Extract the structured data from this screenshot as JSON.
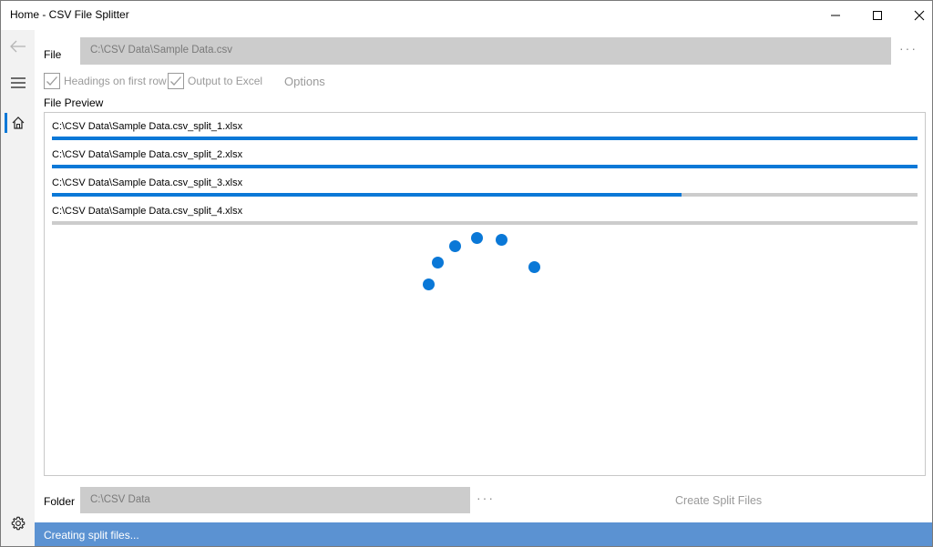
{
  "window": {
    "title": "Home - CSV File Splitter"
  },
  "nav": {
    "back_icon": "back-arrow-icon",
    "menu_icon": "hamburger-icon",
    "home_icon": "home-icon",
    "settings_icon": "gear-icon"
  },
  "file": {
    "label": "File",
    "path": "C:\\CSV Data\\Sample Data.csv",
    "browse": "···"
  },
  "options": {
    "headings_label": "Headings on first row",
    "headings_checked": true,
    "excel_label": "Output to Excel",
    "excel_checked": true,
    "options_label": "Options"
  },
  "preview": {
    "label": "File Preview",
    "items": [
      {
        "name": "C:\\CSV Data\\Sample Data.csv_split_1.xlsx",
        "progress": 1.0
      },
      {
        "name": "C:\\CSV Data\\Sample Data.csv_split_2.xlsx",
        "progress": 1.0
      },
      {
        "name": "C:\\CSV Data\\Sample Data.csv_split_3.xlsx",
        "progress": 0.727
      },
      {
        "name": "C:\\CSV Data\\Sample Data.csv_split_4.xlsx",
        "progress": 0.0
      }
    ]
  },
  "folder": {
    "label": "Folder",
    "path": "C:\\CSV Data",
    "browse": "···"
  },
  "actions": {
    "create_label": "Create Split Files"
  },
  "status": {
    "text": "Creating split files..."
  },
  "colors": {
    "accent": "#0a78d7",
    "status_bar": "#5b92d2",
    "field_bg": "#cccccc"
  }
}
